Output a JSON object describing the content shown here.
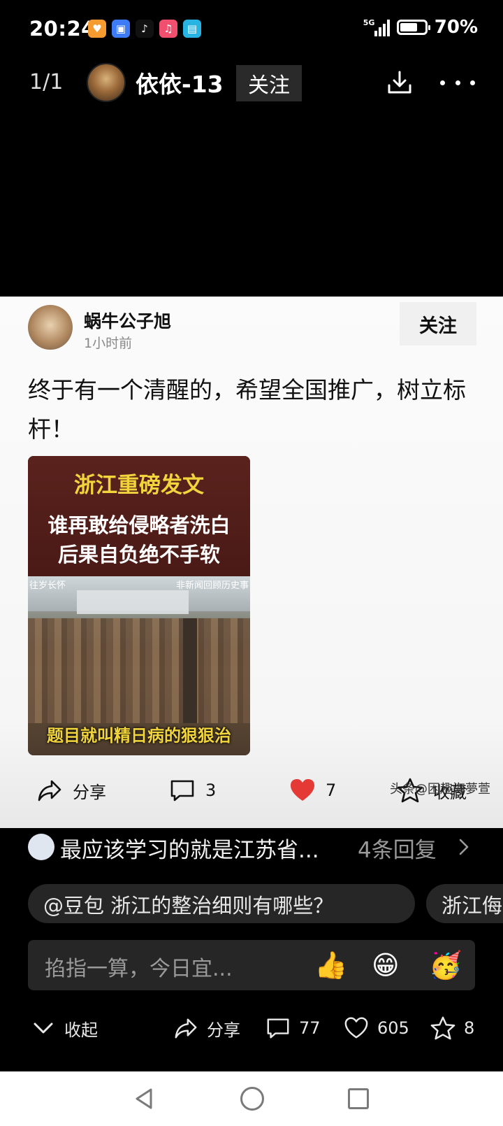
{
  "status_bar": {
    "time": "20:24",
    "network": "5G",
    "battery_percent_label": "70%",
    "battery_level": 0.7,
    "app_icons": [
      {
        "name": "heart-app-icon",
        "color": "#f59b30",
        "glyph": "♥"
      },
      {
        "name": "book-app-icon",
        "color": "#3d7bf7",
        "glyph": "▣"
      },
      {
        "name": "tiktok-app-icon",
        "color": "#111111",
        "glyph": "♪"
      },
      {
        "name": "music-app-icon",
        "color": "#f0506e",
        "glyph": "♫"
      },
      {
        "name": "reader-app-icon",
        "color": "#27b4e3",
        "glyph": "▤"
      }
    ]
  },
  "top_nav": {
    "page_counter": "1/1",
    "author_name": "依依-13",
    "follow_label": "关注"
  },
  "post": {
    "user": "蜗牛公子旭",
    "time": "1小时前",
    "follow_label": "关注",
    "text": "终于有一个清醒的，希望全国推广，树立标杆！",
    "image": {
      "headline": "浙江重磅发文",
      "line1": "谁再敢给侵略者洗白",
      "line2": "后果自负绝不手软",
      "watermark_left": "往岁长怀",
      "watermark_right": "非新闻回顾历史事",
      "bottom_caption": "题目就叫精日病的狠狠治"
    },
    "actions": {
      "share_label": "分享",
      "comment_count": "3",
      "like_count": "7",
      "favorite_label": "收藏"
    },
    "source_tag": "头条@困趣海夢萱"
  },
  "reply_preview": {
    "text": "最应该学习的就是江苏省...",
    "count_label": "4条回复"
  },
  "suggestion_chips": [
    "@豆包 浙江的整治细则有哪些？",
    "浙江侮"
  ],
  "comment_input": {
    "placeholder": "掐指一算，今日宜...",
    "emojis": [
      "👍",
      "😁",
      "🥳"
    ]
  },
  "bottom_actions": {
    "collapse_label": "收起",
    "share_label": "分享",
    "comment_count": "77",
    "like_count": "605",
    "favorite_count": "8"
  },
  "colors": {
    "like_red": "#e53935",
    "image_headline_yellow": "#f2d53c",
    "background": "#000000"
  }
}
